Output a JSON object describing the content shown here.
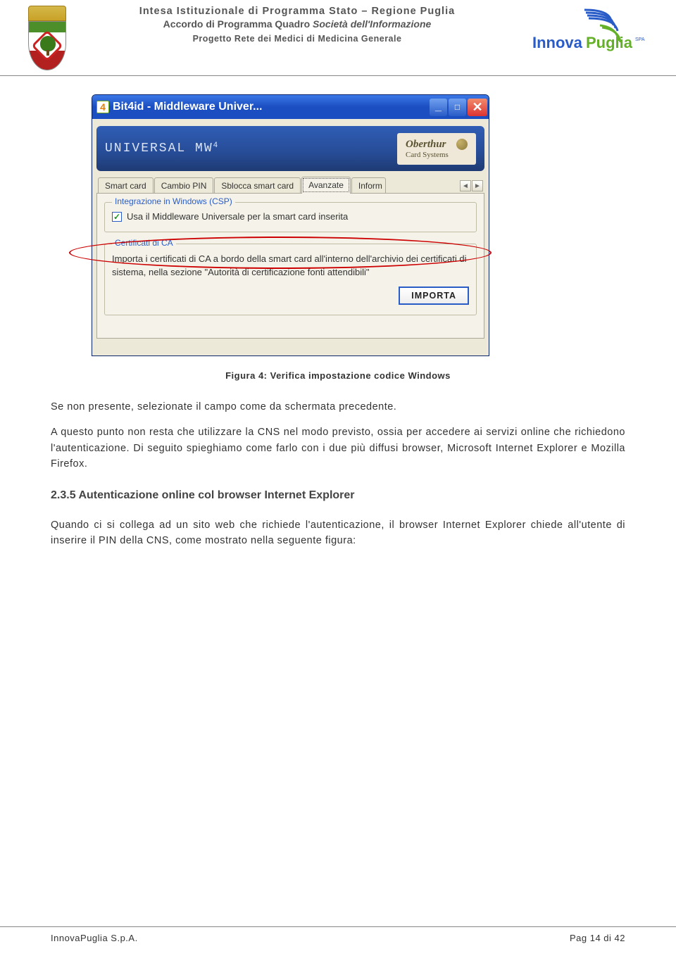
{
  "header": {
    "line1": "Intesa Istituzionale di Programma Stato – Regione Puglia",
    "line2a": "Accordo di Programma Quadro ",
    "line2b": "Società dell'Informazione",
    "line3": "Progetto Rete dei Medici di Medicina Generale",
    "logo_text_a": "Innova",
    "logo_text_b": "Puglia",
    "logo_small": "SPA"
  },
  "screenshot": {
    "title": "Bit4id - Middleware Univer...",
    "brand_left": "UNIVERSAL MW",
    "brand_sup": "4",
    "brand_right_name": "Oberthur",
    "brand_right_sub": "Card Systems",
    "tabs": [
      "Smart card",
      "Cambio PIN",
      "Sblocca smart card",
      "Avanzate",
      "Inform"
    ],
    "active_tab_index": 3,
    "group_csp": {
      "legend": "Integrazione in Windows (CSP)",
      "checkbox_checked": true,
      "checkbox_label": "Usa il Middleware Universale per la smart card inserita"
    },
    "group_ca": {
      "legend": "Certificati di CA",
      "text": "Importa i certificati di CA a bordo della smart card all'interno dell'archivio dei certificati di sistema, nella sezione \"Autorità di certificazione fonti attendibili\"",
      "button": "IMPORTA"
    }
  },
  "caption": "Figura 4: Verifica impostazione codice Windows",
  "para1": "Se non presente, selezionate il campo come da schermata precedente.",
  "para2": "A questo punto non resta che utilizzare la CNS nel modo previsto, ossia per accedere ai servizi online che richiedono l'autenticazione. Di seguito spieghiamo come farlo con i due più diffusi browser, Microsoft Internet Explorer e Mozilla Firefox.",
  "section_title": "2.3.5 Autenticazione online col browser Internet Explorer",
  "para3": "Quando ci si collega ad un sito web che richiede l'autenticazione, il browser Internet Explorer chiede all'utente di inserire il PIN della CNS, come mostrato nella seguente figura:",
  "footer_left": "InnovaPuglia S.p.A.",
  "footer_right": "Pag 14 di 42"
}
